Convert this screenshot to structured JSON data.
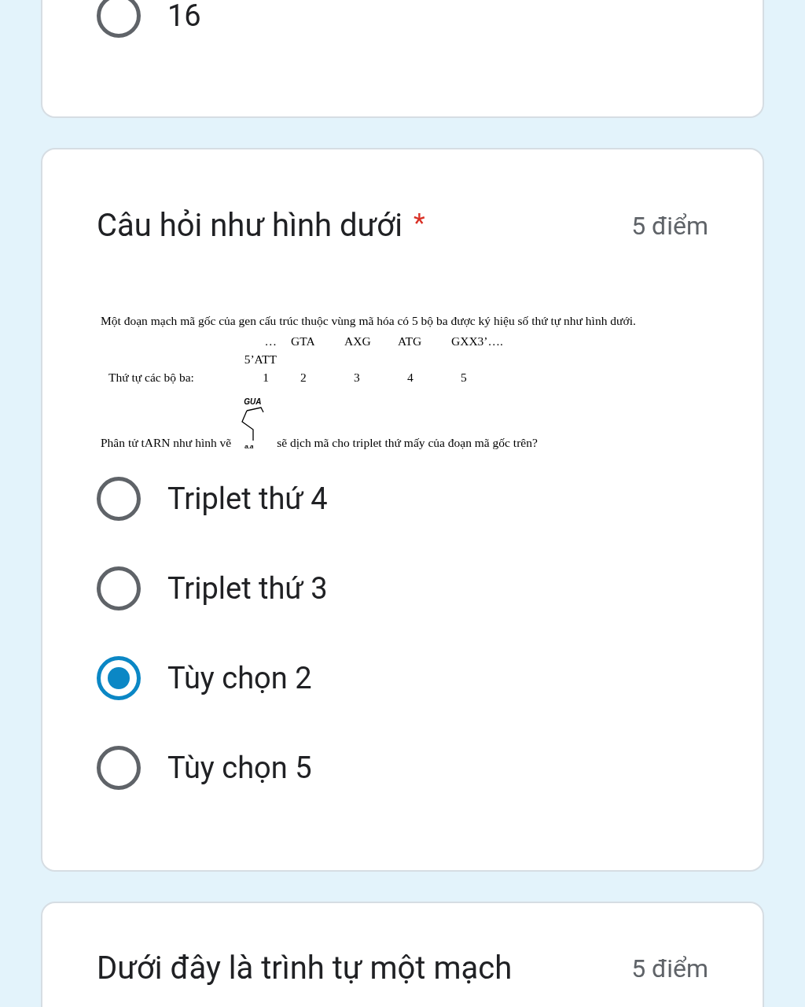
{
  "cards": [
    {
      "options": [
        {
          "label": "16",
          "selected": false
        }
      ]
    },
    {
      "title": "Câu hỏi như hình dưới",
      "required_mark": "*",
      "points": "5 điểm",
      "document": {
        "intro": "Một đoạn mạch mã gốc của gen cấu trúc thuộc vùng mã hóa có 5 bộ ba được ký hiệu số thứ tự như hình dưới.",
        "order_label": "Thứ tự các bộ ba:",
        "codons": [
          {
            "sequence": "…5’ATT",
            "number": "1"
          },
          {
            "sequence": "GTA",
            "number": "2"
          },
          {
            "sequence": "AXG",
            "number": "3"
          },
          {
            "sequence": "ATG",
            "number": "4"
          },
          {
            "sequence": "GXX3’….",
            "number": "5"
          }
        ],
        "trna": {
          "anticodon": "GUA",
          "end_label": "a.a"
        },
        "question_before": "Phân tử tARN như hình vẽ",
        "question_after": "sẽ dịch mã cho triplet thứ mấy của đoạn mã gốc trên?"
      },
      "options": [
        {
          "label": "Triplet thứ 4",
          "selected": false
        },
        {
          "label": "Triplet thứ 3",
          "selected": false
        },
        {
          "label": "Tùy chọn 2",
          "selected": true
        },
        {
          "label": "Tùy chọn 5",
          "selected": false
        }
      ]
    },
    {
      "title": "Dưới đây là trình tự một mạch",
      "points": "5 điểm"
    }
  ]
}
